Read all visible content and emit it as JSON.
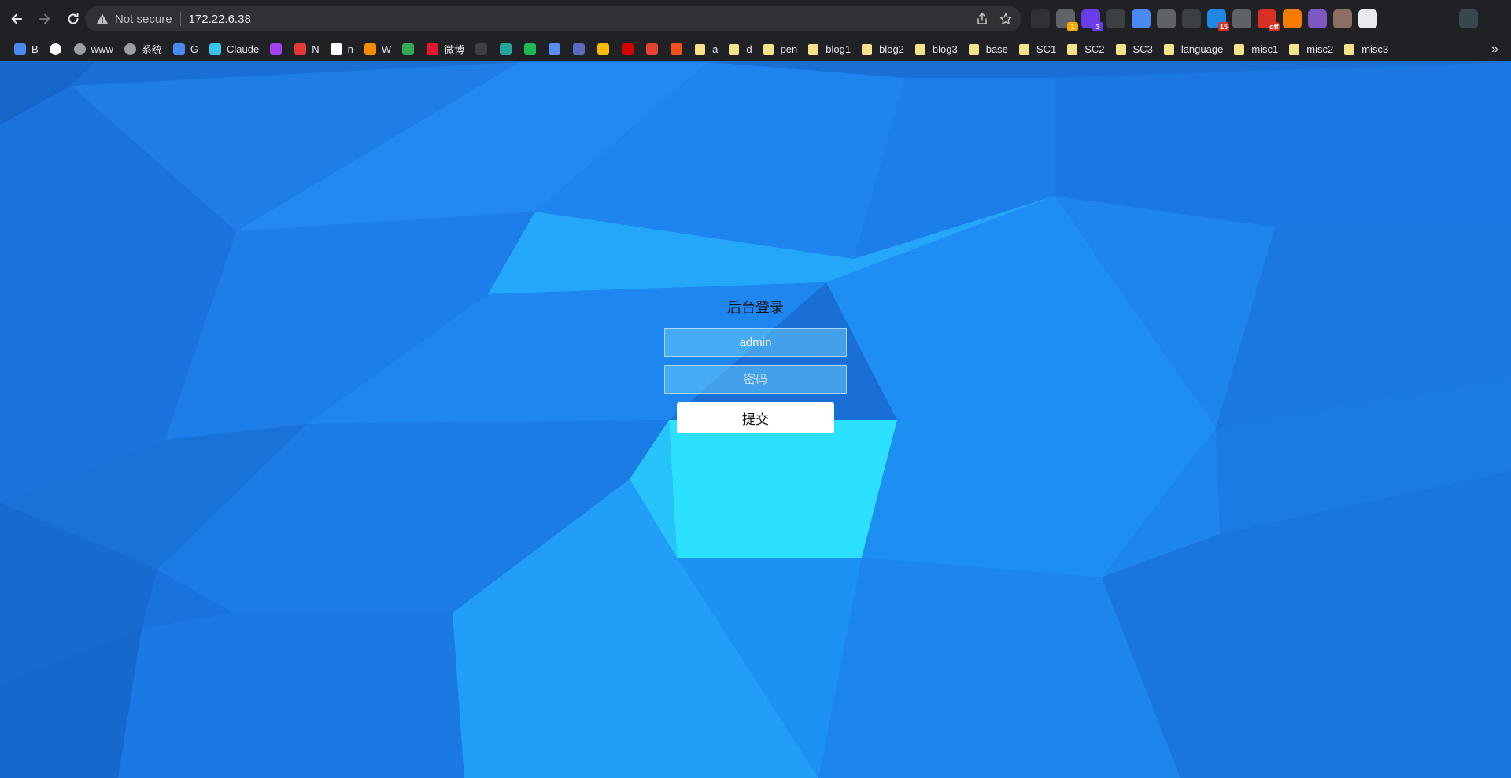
{
  "browser": {
    "security_label": "Not secure",
    "url": "172.22.6.38",
    "extensions": [
      {
        "icon": "mask-icon",
        "badge": "",
        "color": "#303134"
      },
      {
        "icon": "search-ext-icon",
        "badge": "1",
        "color": "#5f6368"
      },
      {
        "icon": "hexagon-icon",
        "badge": "3",
        "color": "#6a3de8"
      },
      {
        "icon": "copy-icon",
        "badge": "",
        "color": "#3c4043"
      },
      {
        "icon": "translate-icon",
        "badge": "",
        "color": "#4a8af4"
      },
      {
        "icon": "circle-ext-icon",
        "badge": "",
        "color": "#5f6368"
      },
      {
        "icon": "eyedropper-icon",
        "badge": "",
        "color": "#3c4043"
      },
      {
        "icon": "grid-ext-icon",
        "badge": "15",
        "color": "#1e88e5"
      },
      {
        "icon": "zip-icon",
        "badge": "",
        "color": "#5f6368"
      },
      {
        "icon": "off-icon",
        "badge": "off",
        "color": "#d93025"
      },
      {
        "icon": "fox-icon",
        "badge": "",
        "color": "#f57c00"
      },
      {
        "icon": "feather-icon",
        "badge": "",
        "color": "#7e57c2"
      },
      {
        "icon": "owl-icon",
        "badge": "",
        "color": "#8d6e63"
      },
      {
        "icon": "reader-icon",
        "badge": "",
        "color": "#e8eaed"
      },
      {
        "icon": "puzzle-icon",
        "badge": "",
        "color": "#202124"
      },
      {
        "icon": "playlist-icon",
        "badge": "",
        "color": "#202124"
      },
      {
        "icon": "sidepanel-icon",
        "badge": "",
        "color": "#202124"
      },
      {
        "icon": "profile-icon",
        "badge": "",
        "color": "#37474f"
      },
      {
        "icon": "menu-icon",
        "badge": "",
        "color": "#202124"
      }
    ]
  },
  "bookmarks": [
    {
      "label": "B",
      "icon": "search-icon",
      "color": "#4a8af4",
      "type": "site"
    },
    {
      "label": "",
      "icon": "google-icon",
      "color": "#ffffff",
      "type": "site"
    },
    {
      "label": "www",
      "icon": "globe-icon",
      "color": "#9aa0a6",
      "type": "site"
    },
    {
      "label": "系统",
      "icon": "globe-icon",
      "color": "#9aa0a6",
      "type": "site"
    },
    {
      "label": "G",
      "icon": "translate-icon",
      "color": "#4a8af4",
      "type": "site"
    },
    {
      "label": "Claude",
      "icon": "slack-icon",
      "color": "#36c5f0",
      "type": "site"
    },
    {
      "label": "",
      "icon": "chat-icon",
      "color": "#a142f4",
      "type": "site"
    },
    {
      "label": "N",
      "icon": "bookmark-icon",
      "color": "#e53935",
      "type": "site"
    },
    {
      "label": "n",
      "icon": "notion-icon",
      "color": "#ffffff",
      "type": "site"
    },
    {
      "label": "W",
      "icon": "bird-icon",
      "color": "#fb8c00",
      "type": "site"
    },
    {
      "label": "",
      "icon": "diamond-icon",
      "color": "#34a853",
      "type": "site"
    },
    {
      "label": "微博",
      "icon": "weibo-icon",
      "color": "#e6162d",
      "type": "site"
    },
    {
      "label": "",
      "icon": "github-icon",
      "color": "#3c4043",
      "type": "site"
    },
    {
      "label": "",
      "icon": "refresh-ring-icon",
      "color": "#26a69a",
      "type": "site"
    },
    {
      "label": "",
      "icon": "p-icon",
      "color": "#1db954",
      "type": "site"
    },
    {
      "label": "",
      "icon": "paw-icon",
      "color": "#5b8def",
      "type": "site"
    },
    {
      "label": "",
      "icon": "q-icon",
      "color": "#5c6bc0",
      "type": "site"
    },
    {
      "label": "",
      "icon": "drive-icon",
      "color": "#fbbc04",
      "type": "site"
    },
    {
      "label": "",
      "icon": "red-icon",
      "color": "#d50000",
      "type": "site"
    },
    {
      "label": "",
      "icon": "gmail-icon",
      "color": "#ea4335",
      "type": "site"
    },
    {
      "label": "",
      "icon": "c-icon",
      "color": "#f4511e",
      "type": "site"
    },
    {
      "label": "a",
      "icon": "folder-icon",
      "type": "folder"
    },
    {
      "label": "d",
      "icon": "folder-icon",
      "type": "folder"
    },
    {
      "label": "pen",
      "icon": "folder-icon",
      "type": "folder"
    },
    {
      "label": "blog1",
      "icon": "folder-icon",
      "type": "folder"
    },
    {
      "label": "blog2",
      "icon": "folder-icon",
      "type": "folder"
    },
    {
      "label": "blog3",
      "icon": "folder-icon",
      "type": "folder"
    },
    {
      "label": "base",
      "icon": "folder-icon",
      "type": "folder"
    },
    {
      "label": "SC1",
      "icon": "folder-icon",
      "type": "folder"
    },
    {
      "label": "SC2",
      "icon": "folder-icon",
      "type": "folder"
    },
    {
      "label": "SC3",
      "icon": "folder-icon",
      "type": "folder"
    },
    {
      "label": "language",
      "icon": "folder-icon",
      "type": "folder"
    },
    {
      "label": "misc1",
      "icon": "folder-icon",
      "type": "folder"
    },
    {
      "label": "misc2",
      "icon": "folder-icon",
      "type": "folder"
    },
    {
      "label": "misc3",
      "icon": "folder-icon",
      "type": "folder"
    }
  ],
  "login": {
    "title": "后台登录",
    "username_value": "admin",
    "password_placeholder": "密码",
    "submit_label": "提交"
  },
  "colors": {
    "page_background": "#1a6fd6",
    "highlight": "#2ee3ff"
  }
}
